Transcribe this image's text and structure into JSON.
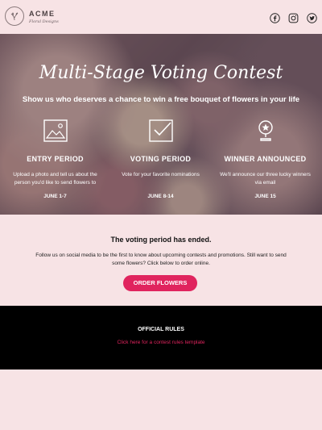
{
  "brand": {
    "name": "ACME",
    "tagline": "Floral Designs"
  },
  "social": {
    "icons": [
      "facebook-icon",
      "instagram-icon",
      "twitter-icon"
    ]
  },
  "hero": {
    "title": "Multi-Stage Voting Contest",
    "subtitle": "Show us who deserves a chance to win a free bouquet of flowers in your life",
    "stages": [
      {
        "icon": "image-icon",
        "title": "ENTRY PERIOD",
        "desc": "Upload a photo and tell us about the person you'd like to send flowers to",
        "date": "JUNE 1-7"
      },
      {
        "icon": "checkbox-icon",
        "title": "VOTING PERIOD",
        "desc": "Vote for your favorite nominations",
        "date": "JUNE 8-14"
      },
      {
        "icon": "trophy-icon",
        "title": "WINNER ANNOUNCED",
        "desc": "We'll announce our three lucky winners via email",
        "date": "JUNE 15"
      }
    ]
  },
  "status": {
    "heading": "The voting period has ended.",
    "body": "Follow us on social media to be the first to know about upcoming contests and promotions. Still want to send some flowers? Click below to order online.",
    "button": "ORDER FLOWERS"
  },
  "rules": {
    "heading": "OFFICIAL RULES",
    "link": "Click here for a contest rules template"
  },
  "colors": {
    "accent": "#e0245e",
    "background": "#f7e3e5",
    "footer": "#000000"
  }
}
